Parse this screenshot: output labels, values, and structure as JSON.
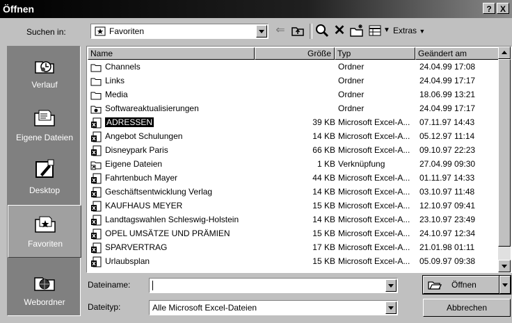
{
  "window": {
    "title": "Öffnen",
    "help_label": "?",
    "close_label": "X"
  },
  "lookin": {
    "label": "Suchen in:",
    "value": "Favoriten"
  },
  "toolbar": {
    "extras_label": "Extras"
  },
  "places": [
    {
      "label": "Verlauf",
      "icon": "history-icon"
    },
    {
      "label": "Eigene Dateien",
      "icon": "my-documents-icon"
    },
    {
      "label": "Desktop",
      "icon": "desktop-icon"
    },
    {
      "label": "Favoriten",
      "icon": "favorites-icon"
    },
    {
      "label": "Webordner",
      "icon": "web-folders-icon"
    }
  ],
  "columns": {
    "name": "Name",
    "size": "Größe",
    "type": "Typ",
    "modified": "Geändert am"
  },
  "files": [
    {
      "name": "Channels",
      "size": "",
      "type": "Ordner",
      "modified": "24.04.99 17:08",
      "icon": "folder-icon"
    },
    {
      "name": "Links",
      "size": "",
      "type": "Ordner",
      "modified": "24.04.99 17:17",
      "icon": "folder-icon"
    },
    {
      "name": "Media",
      "size": "",
      "type": "Ordner",
      "modified": "18.06.99 13:21",
      "icon": "folder-icon"
    },
    {
      "name": "Softwareaktualisierungen",
      "size": "",
      "type": "Ordner",
      "modified": "24.04.99 17:17",
      "icon": "special-folder-icon"
    },
    {
      "name": "ADRESSEN",
      "size": "39 KB",
      "type": "Microsoft Excel-A...",
      "modified": "07.11.97 14:43",
      "icon": "excel-file-icon"
    },
    {
      "name": "Angebot Schulungen",
      "size": "14 KB",
      "type": "Microsoft Excel-A...",
      "modified": "05.12.97 11:14",
      "icon": "excel-file-icon"
    },
    {
      "name": "Disneypark Paris",
      "size": "66 KB",
      "type": "Microsoft Excel-A...",
      "modified": "09.10.97 22:23",
      "icon": "excel-file-icon"
    },
    {
      "name": "Eigene Dateien",
      "size": "1 KB",
      "type": "Verknüpfung",
      "modified": "27.04.99 09:30",
      "icon": "shortcut-icon"
    },
    {
      "name": "Fahrtenbuch Mayer",
      "size": "44 KB",
      "type": "Microsoft Excel-A...",
      "modified": "01.11.97 14:33",
      "icon": "excel-file-icon"
    },
    {
      "name": "Geschäftsentwicklung Verlag",
      "size": "14 KB",
      "type": "Microsoft Excel-A...",
      "modified": "03.10.97 11:48",
      "icon": "excel-file-icon"
    },
    {
      "name": "KAUFHAUS MEYER",
      "size": "15 KB",
      "type": "Microsoft Excel-A...",
      "modified": "12.10.97 09:41",
      "icon": "excel-file-icon"
    },
    {
      "name": "Landtagswahlen Schleswig-Holstein",
      "size": "14 KB",
      "type": "Microsoft Excel-A...",
      "modified": "23.10.97 23:49",
      "icon": "excel-file-icon"
    },
    {
      "name": "OPEL UMSÄTZE UND PRÄMIEN",
      "size": "15 KB",
      "type": "Microsoft Excel-A...",
      "modified": "24.10.97 12:34",
      "icon": "excel-file-icon"
    },
    {
      "name": "SPARVERTRAG",
      "size": "17 KB",
      "type": "Microsoft Excel-A...",
      "modified": "21.01.98 01:11",
      "icon": "excel-file-icon"
    },
    {
      "name": "Urlaubsplan",
      "size": "15 KB",
      "type": "Microsoft Excel-A...",
      "modified": "05.09.97 09:38",
      "icon": "excel-file-icon"
    }
  ],
  "filename": {
    "label": "Dateiname:",
    "value": ""
  },
  "filetype": {
    "label": "Dateityp:",
    "value": "Alle Microsoft Excel-Dateien"
  },
  "buttons": {
    "open": "Öffnen",
    "cancel": "Abbrechen"
  }
}
